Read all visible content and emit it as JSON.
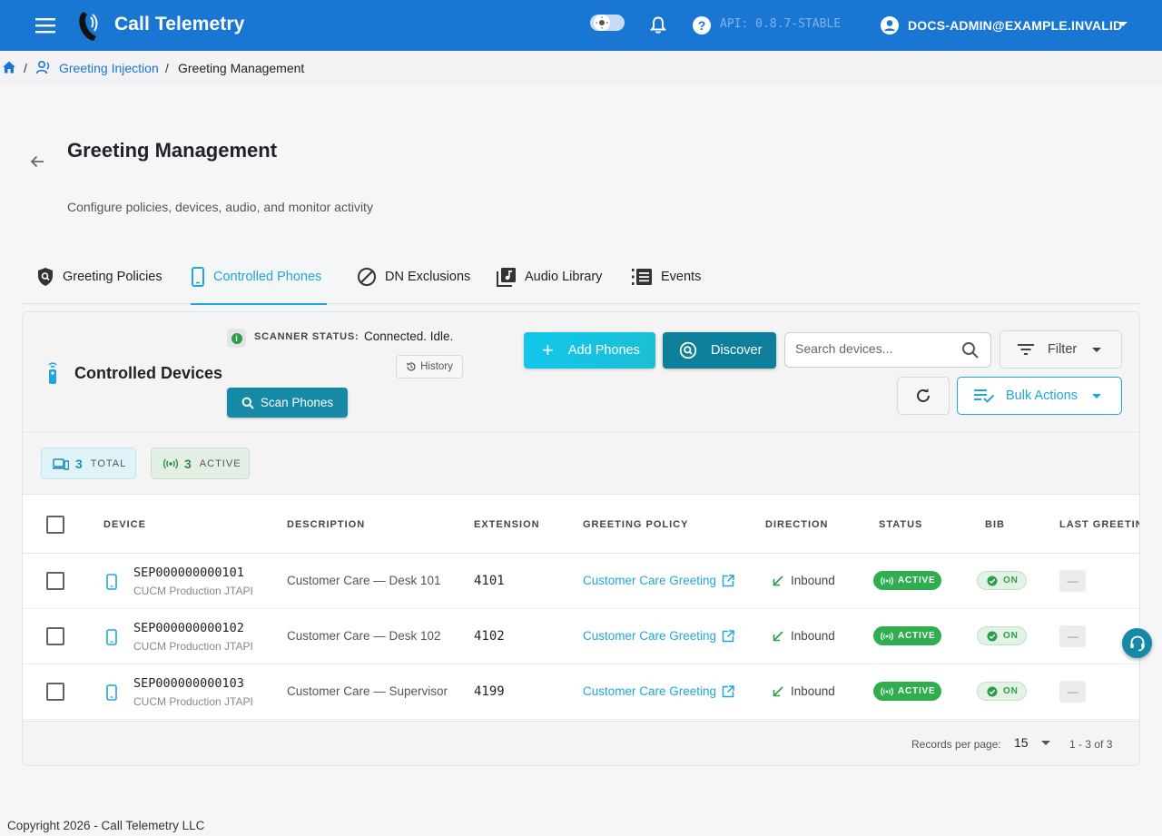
{
  "app": {
    "brand": "Call Telemetry",
    "api_version": "API: 0.8.7-STABLE",
    "account": "DOCS-ADMIN@EXAMPLE.INVALID",
    "accent_color": "#1976d2",
    "icons": [
      "menu-icon",
      "logo-icon",
      "theme-toggle-icon",
      "bell-icon",
      "help-icon",
      "account-icon"
    ]
  },
  "breadcrumb": {
    "items": [
      "Greeting Injection",
      "Greeting Management"
    ],
    "separator": "/"
  },
  "header": {
    "title": "Greeting Management",
    "subtitle": "Configure policies, devices, audio, and monitor activity"
  },
  "tabs": [
    {
      "label": "Greeting Policies",
      "icon": "shield-search-icon"
    },
    {
      "label": "Controlled Phones",
      "icon": "phone-icon",
      "active": true
    },
    {
      "label": "DN Exclusions",
      "icon": "block-icon"
    },
    {
      "label": "Audio Library",
      "icon": "music-library-icon"
    },
    {
      "label": "Events",
      "icon": "list-icon"
    }
  ],
  "card": {
    "title": "Controlled Devices",
    "scanner_label": "SCANNER STATUS:",
    "scanner_value": "Connected. Idle.",
    "history_label": "History",
    "scan_label": "Scan Phones",
    "add_label": "Add Phones",
    "discover_label": "Discover",
    "search_placeholder": "Search devices...",
    "filter_label": "Filter",
    "bulk_label": "Bulk Actions"
  },
  "stats": {
    "total": {
      "value": "3",
      "label": "TOTAL"
    },
    "active": {
      "value": "3",
      "label": "ACTIVE"
    }
  },
  "table": {
    "columns": [
      "DEVICE",
      "DESCRIPTION",
      "EXTENSION",
      "GREETING POLICY",
      "DIRECTION",
      "STATUS",
      "BIB",
      "LAST GREETING"
    ],
    "rows": [
      {
        "device": "SEP000000000101",
        "source": "CUCM Production JTAPI",
        "description": "Customer Care — Desk 101",
        "extension": "4101",
        "policy": "Customer Care Greeting",
        "direction": "Inbound",
        "status": "ACTIVE",
        "bib": "ON",
        "last": "—"
      },
      {
        "device": "SEP000000000102",
        "source": "CUCM Production JTAPI",
        "description": "Customer Care — Desk 102",
        "extension": "4102",
        "policy": "Customer Care Greeting",
        "direction": "Inbound",
        "status": "ACTIVE",
        "bib": "ON",
        "last": "—"
      },
      {
        "device": "SEP000000000103",
        "source": "CUCM Production JTAPI",
        "description": "Customer Care — Supervisor",
        "extension": "4199",
        "policy": "Customer Care Greeting",
        "direction": "Inbound",
        "status": "ACTIVE",
        "bib": "ON",
        "last": "—"
      }
    ]
  },
  "pagination": {
    "records_label": "Records per page:",
    "per_page": "15",
    "range": "1 - 3 of 3"
  },
  "footer": {
    "copyright": "Copyright 2026 - Call Telemetry LLC"
  }
}
